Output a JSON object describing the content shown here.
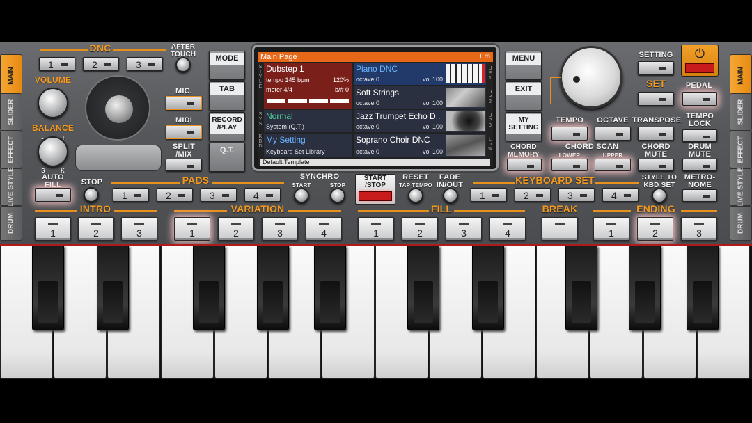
{
  "side_left": [
    "MAIN",
    "SLIDER",
    "EFFECT",
    "LIVE STYLE",
    "DRUM"
  ],
  "side_right": [
    "MAIN",
    "SLIDER",
    "EFFECT",
    "LIVE STYLE",
    "DRUM"
  ],
  "dnc": {
    "label": "DNC",
    "buttons": [
      "1",
      "2",
      "3"
    ]
  },
  "after_touch": "AFTER TOUCH",
  "volume": "VOLUME",
  "balance": "BALANCE",
  "balance_marks": {
    "minus": "-",
    "plus": "+",
    "s": "S",
    "k": "K"
  },
  "mic": "MIC.",
  "midi": "MIDI",
  "split_mix": "SPLIT /MIX",
  "left_col_buttons": [
    "MODE",
    "TAB",
    "RECORD /PLAY",
    "Q.T."
  ],
  "lcd": {
    "title": "Main Page",
    "title_right": "Em",
    "style_name": "Dubstep 1",
    "tempo": "tempo 145 bpm",
    "tempo_pct": "120%",
    "meter": "meter 4/4",
    "bsharp": "b/# 0",
    "sys_name": "Normal",
    "sys_sub": "System (Q.T.)",
    "kbd_name": "My Setting",
    "kbd_sub": "Keyboard Set Library",
    "footer": "Default.Template",
    "left_vert": [
      "S T Y L E",
      "S Y S",
      "K B D"
    ],
    "right_vert": [
      "U P 1",
      "U P 2",
      "U P 3",
      "L o w"
    ],
    "parts": [
      {
        "name": "Piano DNC",
        "octave": "octave  0",
        "vol": "vol 100"
      },
      {
        "name": "Soft Strings",
        "octave": "octave  0",
        "vol": "vol 100"
      },
      {
        "name": "Jazz Trumpet Echo D..",
        "octave": "octave  0",
        "vol": "vol 100"
      },
      {
        "name": "Soprano Choir DNC",
        "octave": "octave  0",
        "vol": "vol 100"
      }
    ]
  },
  "right_col_buttons": [
    "MENU",
    "EXIT",
    "MY SETTING",
    "CHORD MEMORY"
  ],
  "setting": "SETTING",
  "set": "SET",
  "pedal": "PEDAL",
  "tempo": "TEMPO",
  "octave": "OCTAVE",
  "transpose": "TRANSPOSE",
  "tempo_lock": "TEMPO LOCK",
  "chord_scan": "CHORD SCAN",
  "lower": "LOWER",
  "upper": "UPPER",
  "chord_mute": "CHORD MUTE",
  "drum_mute": "DRUM MUTE",
  "auto_fill": "AUTO FILL",
  "stop": "STOP",
  "pads": {
    "label": "PADS",
    "buttons": [
      "1",
      "2",
      "3",
      "4"
    ]
  },
  "synchro": "SYNCHRO",
  "synchro_start": "START",
  "synchro_stop": "STOP",
  "start_stop": "START /STOP",
  "reset": "RESET",
  "tap_tempo": "TAP TEMPO",
  "fade": "FADE IN/OUT",
  "keyboard_set": {
    "label": "KEYBOARD SET",
    "buttons": [
      "1",
      "2",
      "3",
      "4"
    ]
  },
  "style_to_kbd": "STYLE TO KBD SET",
  "metronome": "METRO- NOME",
  "intro": {
    "label": "INTRO",
    "buttons": [
      "1",
      "2",
      "3"
    ]
  },
  "variation": {
    "label": "VARIATION",
    "buttons": [
      "1",
      "2",
      "3",
      "4"
    ]
  },
  "fill": {
    "label": "FILL",
    "buttons": [
      "1",
      "2",
      "3",
      "4"
    ]
  },
  "break": {
    "label": "BREAK",
    "buttons": [
      ""
    ]
  },
  "ending": {
    "label": "ENDING",
    "buttons": [
      "1",
      "2",
      "3"
    ]
  },
  "colors": {
    "accent": "#f59a1e",
    "lcd_header": "#e8681a",
    "power": "#d42020"
  },
  "icons": {
    "power": "power-icon",
    "joystick": "joystick-icon",
    "dial": "tempo-dial-icon"
  }
}
